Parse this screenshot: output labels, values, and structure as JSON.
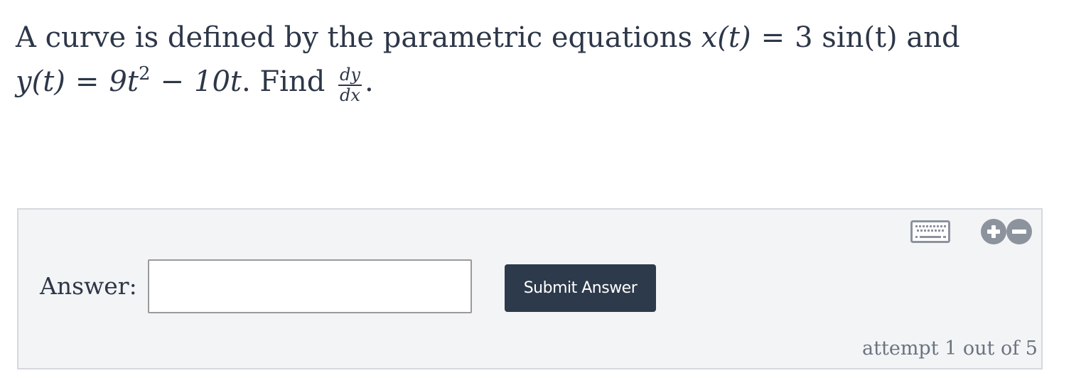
{
  "question": {
    "line1_prefix": "A curve is defined by the parametric equations ",
    "x_func": "x(t)",
    "equals": "=",
    "x_expr": "3 sin(t)",
    "line1_suffix": " and",
    "y_func": "y(t)",
    "y_coef": "9t",
    "y_exp": "2",
    "minus": "−",
    "y_term2": "10t",
    "find_text": ". Find ",
    "frac_num": "dy",
    "frac_den": "dx",
    "end_period": "."
  },
  "answer": {
    "label": "Answer:",
    "input_value": "",
    "input_placeholder": "",
    "submit_label": "Submit Answer",
    "attempt_text": "attempt 1 out of 5"
  },
  "icons": {
    "keyboard": "keyboard-icon",
    "increase": "plus-circle-icon",
    "decrease": "minus-circle-icon"
  },
  "colors": {
    "text": "#2d3748",
    "panel_bg": "#f3f4f6",
    "button_bg": "#2d3a4b",
    "icon_gray": "#8c939d"
  }
}
